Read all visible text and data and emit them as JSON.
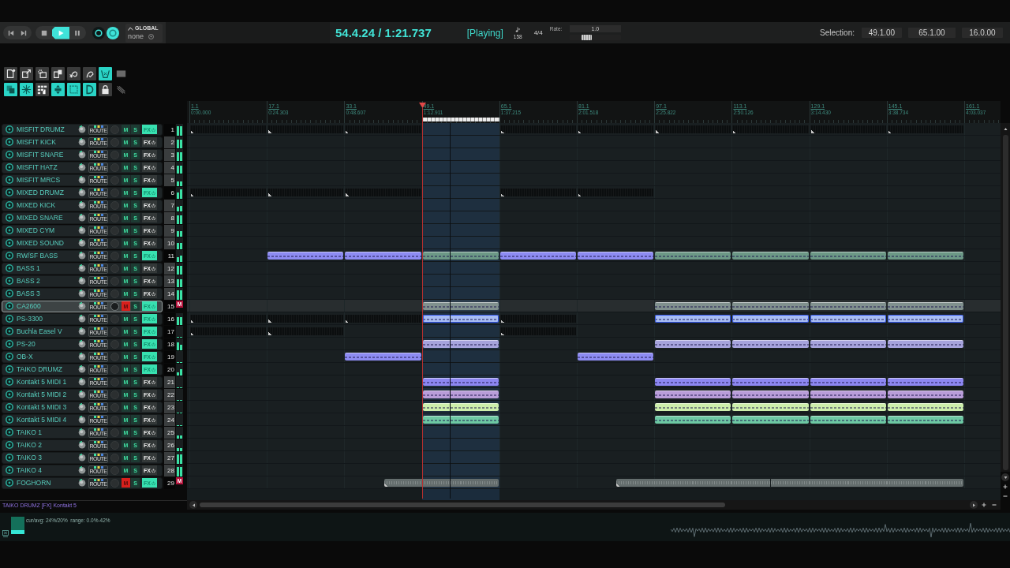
{
  "transport": {
    "groups": [
      {
        "kind": "pill",
        "buttons": [
          {
            "kind": "skipback",
            "on": false
          },
          {
            "kind": "skipforward",
            "on": false
          }
        ]
      },
      {
        "kind": "pill",
        "buttons": [
          {
            "kind": "stop",
            "on": false
          },
          {
            "kind": "play",
            "on": true
          },
          {
            "kind": "pause",
            "on": false
          }
        ]
      },
      {
        "kind": "plain",
        "buttons": [
          {
            "kind": "record",
            "on": false
          },
          {
            "kind": "repeat",
            "on": true
          }
        ]
      }
    ],
    "automation": {
      "label": "GLOBAL",
      "value": "none"
    }
  },
  "position": "54.4.24 / 1:21.737",
  "play_state": "[Playing]",
  "tempo": "158",
  "time_signature": "4/4",
  "rate": {
    "label": "Rate:",
    "value": "1.0",
    "level": 0.29
  },
  "selection": {
    "label": "Selection:",
    "start": "49.1.00",
    "end": "65.1.00",
    "length": "16.0.00"
  },
  "toolbar": {
    "rows": [
      {
        "buttons": [
          {
            "kind": "new",
            "on": false
          },
          {
            "kind": "saveas",
            "on": false
          },
          {
            "kind": "settings",
            "on": false
          },
          {
            "kind": "history",
            "on": false
          },
          {
            "kind": "erase",
            "on": false
          },
          {
            "kind": "apply",
            "on": false
          },
          {
            "kind": "envelope",
            "on": true
          },
          {
            "kind": "marquee",
            "on": false
          }
        ]
      },
      {
        "buttons": [
          {
            "kind": "copy",
            "on": true
          },
          {
            "kind": "burst",
            "on": true
          },
          {
            "kind": "grid",
            "on": false
          },
          {
            "kind": "expand",
            "on": true
          },
          {
            "kind": "snap",
            "on": true
          },
          {
            "kind": "loop",
            "on": true
          },
          {
            "kind": "lock",
            "on": false
          },
          {
            "kind": "trim",
            "on": false
          }
        ]
      }
    ]
  },
  "ruler": {
    "marks": [
      {
        "bar": "1.1",
        "time": "0:00.000"
      },
      {
        "bar": "17.1",
        "time": "0:24.303"
      },
      {
        "bar": "33.1",
        "time": "0:48.607"
      },
      {
        "bar": "49.1",
        "time": "1:12.911"
      },
      {
        "bar": "65.1",
        "time": "1:37.215"
      },
      {
        "bar": "81.1",
        "time": "2:01.518"
      },
      {
        "bar": "97.1",
        "time": "2:25.822"
      },
      {
        "bar": "113.1",
        "time": "2:50.126"
      },
      {
        "bar": "129.1",
        "time": "3:14.430"
      },
      {
        "bar": "145.1",
        "time": "3:38.734"
      },
      {
        "bar": "161.1",
        "time": "4:03.037"
      }
    ]
  },
  "tracks": [
    {
      "number": "1",
      "name": "MISFIT DRUMZ",
      "route_label": "ROUTE",
      "mute_label": "M",
      "solo_label": "S",
      "fx_label": "FX",
      "muted": false,
      "fx_on": true,
      "selected": false,
      "meter": [
        {
          "level": 0.9
        },
        {
          "level": 0.9
        }
      ],
      "slots": [
        {
          "kind": "empty",
          "selected": false
        },
        {
          "kind": "empty",
          "selected": false
        },
        {
          "kind": "empty",
          "selected": false
        },
        {
          "kind": "gap"
        },
        {
          "kind": "empty",
          "selected": false
        },
        {
          "kind": "empty",
          "selected": false
        },
        {
          "kind": "empty",
          "selected": false
        },
        {
          "kind": "empty",
          "selected": false
        },
        {
          "kind": "empty",
          "selected": false
        },
        {
          "kind": "empty",
          "selected": false
        }
      ]
    },
    {
      "number": "2",
      "name": "MISFIT KICK",
      "route_label": "ROUTE",
      "mute_label": "M",
      "solo_label": "S",
      "fx_label": "FX",
      "muted": false,
      "fx_on": false,
      "selected": false,
      "meter": [
        {
          "level": 0.8
        },
        {
          "level": 0.8
        }
      ]
    },
    {
      "number": "3",
      "name": "MISFIT SNARE",
      "route_label": "ROUTE",
      "mute_label": "M",
      "solo_label": "S",
      "fx_label": "FX",
      "muted": false,
      "fx_on": false,
      "selected": false,
      "meter": [
        {
          "level": 0.8
        },
        {
          "level": 0.8
        }
      ]
    },
    {
      "number": "4",
      "name": "MISFIT HATZ",
      "route_label": "ROUTE",
      "mute_label": "M",
      "solo_label": "S",
      "fx_label": "FX",
      "muted": false,
      "fx_on": false,
      "selected": false,
      "meter": [
        {
          "level": 0.7
        },
        {
          "level": 0.7
        }
      ]
    },
    {
      "number": "5",
      "name": "MISFIT MRCS",
      "route_label": "ROUTE",
      "mute_label": "M",
      "solo_label": "S",
      "fx_label": "FX",
      "muted": false,
      "fx_on": false,
      "selected": false,
      "meter": [
        {
          "level": 0.4
        },
        {
          "level": 0.4
        }
      ]
    },
    {
      "number": "6",
      "name": "MIXED DRUMZ",
      "route_label": "ROUTE",
      "mute_label": "M",
      "solo_label": "S",
      "fx_label": "FX",
      "muted": false,
      "fx_on": true,
      "selected": false,
      "meter": [
        {
          "level": 0.6
        },
        {
          "level": 0.9
        }
      ],
      "slots": [
        {
          "kind": "empty",
          "selected": false
        },
        {
          "kind": "empty",
          "selected": false
        },
        {
          "kind": "empty",
          "selected": false
        },
        {
          "kind": "gap"
        },
        {
          "kind": "empty",
          "selected": false
        },
        {
          "kind": "empty",
          "selected": false
        },
        {
          "kind": "gap"
        },
        {
          "kind": "gap"
        },
        {
          "kind": "gap"
        },
        {
          "kind": "gap"
        }
      ]
    },
    {
      "number": "7",
      "name": "MIXED KICK",
      "route_label": "ROUTE",
      "mute_label": "M",
      "solo_label": "S",
      "fx_label": "FX",
      "muted": false,
      "fx_on": false,
      "selected": false,
      "meter": [
        {
          "level": 0.4
        },
        {
          "level": 0.5
        }
      ]
    },
    {
      "number": "8",
      "name": "MIXED SNARE",
      "route_label": "ROUTE",
      "mute_label": "M",
      "solo_label": "S",
      "fx_label": "FX",
      "muted": false,
      "fx_on": false,
      "selected": false,
      "meter": [
        {
          "level": 0.8
        },
        {
          "level": 0.8
        }
      ]
    },
    {
      "number": "9",
      "name": "MIXED CYM",
      "route_label": "ROUTE",
      "mute_label": "M",
      "solo_label": "S",
      "fx_label": "FX",
      "muted": false,
      "fx_on": false,
      "selected": false,
      "meter": [
        {
          "level": 0.5
        },
        {
          "level": 0.5
        }
      ]
    },
    {
      "number": "10",
      "name": "MIXED SOUND",
      "route_label": "ROUTE",
      "mute_label": "M",
      "solo_label": "S",
      "fx_label": "FX",
      "muted": false,
      "fx_on": false,
      "selected": false,
      "meter": [
        {
          "level": 0.6
        },
        {
          "level": 0.6
        }
      ]
    },
    {
      "number": "11",
      "name": "RW/SF BASS",
      "route_label": "ROUTE",
      "mute_label": "M",
      "solo_label": "S",
      "fx_label": "FX",
      "muted": false,
      "fx_on": true,
      "selected": false,
      "meter": [
        {
          "level": 0.4
        },
        {
          "level": 0.6
        }
      ],
      "slots": [
        {
          "kind": "gap"
        },
        {
          "kind": "midi",
          "color": "#8d8bf2",
          "selected": false
        },
        {
          "kind": "midi",
          "color": "#8d8bf2",
          "selected": false
        },
        {
          "kind": "midi",
          "color": "#6c9886",
          "selected": false
        },
        {
          "kind": "midi",
          "color": "#8d8bf2",
          "selected": false
        },
        {
          "kind": "midi",
          "color": "#8d8bf2",
          "selected": false
        },
        {
          "kind": "midi",
          "color": "#6c9886",
          "selected": false
        },
        {
          "kind": "midi",
          "color": "#6c9886",
          "selected": false
        },
        {
          "kind": "midi",
          "color": "#6c9886",
          "selected": false
        },
        {
          "kind": "midi",
          "color": "#6c9886",
          "selected": false
        }
      ]
    },
    {
      "number": "12",
      "name": "BASS 1",
      "route_label": "ROUTE",
      "mute_label": "M",
      "solo_label": "S",
      "fx_label": "FX",
      "muted": false,
      "fx_on": false,
      "selected": false,
      "meter": [
        {
          "level": 0.8
        },
        {
          "level": 0.8
        }
      ]
    },
    {
      "number": "13",
      "name": "BASS 2",
      "route_label": "ROUTE",
      "mute_label": "M",
      "solo_label": "S",
      "fx_label": "FX",
      "muted": false,
      "fx_on": false,
      "selected": false,
      "meter": [
        {
          "level": 0.7
        },
        {
          "level": 0.7
        }
      ]
    },
    {
      "number": "14",
      "name": "BASS 3",
      "route_label": "ROUTE",
      "mute_label": "M",
      "solo_label": "S",
      "fx_label": "FX",
      "muted": false,
      "fx_on": false,
      "selected": false,
      "meter": [
        {
          "level": 0.9
        },
        {
          "level": 0.9
        }
      ]
    },
    {
      "number": "15",
      "name": "CA2600",
      "route_label": "ROUTE",
      "mute_label": "M",
      "solo_label": "S",
      "fx_label": "FX",
      "muted": true,
      "fx_on": true,
      "selected": true,
      "meter_badge": "M",
      "slots": [
        {
          "kind": "gap"
        },
        {
          "kind": "gap"
        },
        {
          "kind": "gap"
        },
        {
          "kind": "midi",
          "color": "#80908e",
          "selected": false
        },
        {
          "kind": "gap"
        },
        {
          "kind": "gap"
        },
        {
          "kind": "midi",
          "color": "#80908e",
          "selected": false
        },
        {
          "kind": "midi",
          "color": "#80908e",
          "selected": false
        },
        {
          "kind": "midi",
          "color": "#80908e",
          "selected": false
        },
        {
          "kind": "midi",
          "color": "#80908e",
          "selected": false
        }
      ]
    },
    {
      "number": "16",
      "name": "PS-3300",
      "route_label": "ROUTE",
      "mute_label": "M",
      "solo_label": "S",
      "fx_label": "FX",
      "muted": false,
      "fx_on": true,
      "selected": false,
      "meter": [
        {
          "level": 0.7
        },
        {
          "level": 0.7
        }
      ],
      "slots": [
        {
          "kind": "empty",
          "selected": false
        },
        {
          "kind": "empty",
          "selected": false
        },
        {
          "kind": "empty",
          "selected": false
        },
        {
          "kind": "midi",
          "color": "#a8bdf4",
          "selected": true
        },
        {
          "kind": "empty",
          "selected": false
        },
        {
          "kind": "gap"
        },
        {
          "kind": "midi",
          "color": "#a8bdf4",
          "selected": true
        },
        {
          "kind": "midi",
          "color": "#a8bdf4",
          "selected": true
        },
        {
          "kind": "midi",
          "color": "#a8bdf4",
          "selected": true
        },
        {
          "kind": "midi",
          "color": "#a8bdf4",
          "selected": true
        }
      ]
    },
    {
      "number": "17",
      "name": "Buchla Easel V",
      "route_label": "ROUTE",
      "mute_label": "M",
      "solo_label": "S",
      "fx_label": "FX",
      "muted": false,
      "fx_on": true,
      "selected": false,
      "meter": [
        {
          "level": 0
        },
        {
          "level": 0
        }
      ],
      "slots": [
        {
          "kind": "empty",
          "selected": false
        },
        {
          "kind": "empty",
          "selected": false
        },
        {
          "kind": "gap"
        },
        {
          "kind": "gap"
        },
        {
          "kind": "empty",
          "selected": false
        },
        {
          "kind": "gap"
        },
        {
          "kind": "gap"
        },
        {
          "kind": "gap"
        },
        {
          "kind": "gap"
        },
        {
          "kind": "gap"
        }
      ]
    },
    {
      "number": "18",
      "name": "PS-20",
      "route_label": "ROUTE",
      "mute_label": "M",
      "solo_label": "S",
      "fx_label": "FX",
      "muted": false,
      "fx_on": true,
      "selected": false,
      "meter": [
        {
          "level": 0.7
        },
        {
          "level": 0.5
        }
      ],
      "slots": [
        {
          "kind": "gap"
        },
        {
          "kind": "gap"
        },
        {
          "kind": "gap"
        },
        {
          "kind": "midi",
          "color": "#a6a3dc",
          "selected": false
        },
        {
          "kind": "gap"
        },
        {
          "kind": "gap"
        },
        {
          "kind": "midi",
          "color": "#a6a3dc",
          "selected": false
        },
        {
          "kind": "midi",
          "color": "#a6a3dc",
          "selected": false
        },
        {
          "kind": "midi",
          "color": "#a6a3dc",
          "selected": false
        },
        {
          "kind": "midi",
          "color": "#a6a3dc",
          "selected": false
        }
      ]
    },
    {
      "number": "19",
      "name": "OB-X",
      "route_label": "ROUTE",
      "mute_label": "M",
      "solo_label": "S",
      "fx_label": "FX",
      "muted": false,
      "fx_on": true,
      "selected": false,
      "meter": [
        {
          "level": 0
        },
        {
          "level": 0
        }
      ],
      "slots": [
        {
          "kind": "gap"
        },
        {
          "kind": "gap"
        },
        {
          "kind": "midi",
          "color": "#8d8bf2",
          "selected": false
        },
        {
          "kind": "gap"
        },
        {
          "kind": "gap"
        },
        {
          "kind": "midi",
          "color": "#8d8bf2",
          "selected": false
        },
        {
          "kind": "gap"
        },
        {
          "kind": "gap"
        },
        {
          "kind": "gap"
        },
        {
          "kind": "gap"
        }
      ]
    },
    {
      "number": "20",
      "name": "TAIKO DRUMZ",
      "route_label": "ROUTE",
      "mute_label": "M",
      "solo_label": "S",
      "fx_label": "FX",
      "muted": false,
      "fx_on": true,
      "selected": false,
      "meter": [
        {
          "level": 0.3
        },
        {
          "level": 0.6
        }
      ]
    },
    {
      "number": "21",
      "name": "Kontakt 5 MIDI 1",
      "route_label": "ROUTE",
      "mute_label": "M",
      "solo_label": "S",
      "fx_label": "FX",
      "muted": false,
      "fx_on": false,
      "selected": false,
      "meter": [
        {
          "level": 0
        },
        {
          "level": 0
        }
      ],
      "slots": [
        {
          "kind": "gap"
        },
        {
          "kind": "gap"
        },
        {
          "kind": "gap"
        },
        {
          "kind": "midi",
          "color": "#8d87f2",
          "selected": false
        },
        {
          "kind": "gap"
        },
        {
          "kind": "gap"
        },
        {
          "kind": "midi",
          "color": "#8d87f2",
          "selected": false
        },
        {
          "kind": "midi",
          "color": "#8d87f2",
          "selected": false
        },
        {
          "kind": "midi",
          "color": "#8d87f2",
          "selected": false
        },
        {
          "kind": "midi",
          "color": "#8d87f2",
          "selected": false
        }
      ]
    },
    {
      "number": "22",
      "name": "Kontakt 5 MIDI 2",
      "route_label": "ROUTE",
      "mute_label": "M",
      "solo_label": "S",
      "fx_label": "FX",
      "muted": false,
      "fx_on": false,
      "selected": false,
      "meter": [
        {
          "level": 0
        },
        {
          "level": 0
        }
      ],
      "slots": [
        {
          "kind": "gap"
        },
        {
          "kind": "gap"
        },
        {
          "kind": "gap"
        },
        {
          "kind": "midi",
          "color": "#b99dd9",
          "selected": false
        },
        {
          "kind": "gap"
        },
        {
          "kind": "gap"
        },
        {
          "kind": "midi",
          "color": "#b99dd9",
          "selected": false
        },
        {
          "kind": "midi",
          "color": "#b99dd9",
          "selected": false
        },
        {
          "kind": "midi",
          "color": "#b99dd9",
          "selected": false
        },
        {
          "kind": "midi",
          "color": "#b99dd9",
          "selected": false
        }
      ]
    },
    {
      "number": "23",
      "name": "Kontakt 5 MIDI 3",
      "route_label": "ROUTE",
      "mute_label": "M",
      "solo_label": "S",
      "fx_label": "FX",
      "muted": false,
      "fx_on": false,
      "selected": false,
      "meter": [
        {
          "level": 0
        },
        {
          "level": 0
        }
      ],
      "slots": [
        {
          "kind": "gap"
        },
        {
          "kind": "gap"
        },
        {
          "kind": "gap"
        },
        {
          "kind": "midi",
          "color": "#cdeeab",
          "selected": false
        },
        {
          "kind": "gap"
        },
        {
          "kind": "gap"
        },
        {
          "kind": "midi",
          "color": "#cdeeab",
          "selected": false
        },
        {
          "kind": "midi",
          "color": "#cdeeab",
          "selected": false
        },
        {
          "kind": "midi",
          "color": "#cdeeab",
          "selected": false
        },
        {
          "kind": "midi",
          "color": "#cdeeab",
          "selected": false
        }
      ]
    },
    {
      "number": "24",
      "name": "Kontakt 5 MIDI 4",
      "route_label": "ROUTE",
      "mute_label": "M",
      "solo_label": "S",
      "fx_label": "FX",
      "muted": false,
      "fx_on": false,
      "selected": false,
      "meter": [
        {
          "level": 0
        },
        {
          "level": 0
        }
      ],
      "slots": [
        {
          "kind": "gap"
        },
        {
          "kind": "gap"
        },
        {
          "kind": "gap"
        },
        {
          "kind": "midi",
          "color": "#6dc8a3",
          "selected": false
        },
        {
          "kind": "gap"
        },
        {
          "kind": "gap"
        },
        {
          "kind": "midi",
          "color": "#6dc8a3",
          "selected": false
        },
        {
          "kind": "midi",
          "color": "#6dc8a3",
          "selected": false
        },
        {
          "kind": "midi",
          "color": "#6dc8a3",
          "selected": false
        },
        {
          "kind": "midi",
          "color": "#6dc8a3",
          "selected": false
        }
      ]
    },
    {
      "number": "25",
      "name": "TAIKO 1",
      "route_label": "ROUTE",
      "mute_label": "M",
      "solo_label": "S",
      "fx_label": "FX",
      "muted": false,
      "fx_on": false,
      "selected": false,
      "meter": [
        {
          "level": 0.3
        },
        {
          "level": 0.3
        }
      ]
    },
    {
      "number": "26",
      "name": "TAIKO 2",
      "route_label": "ROUTE",
      "mute_label": "M",
      "solo_label": "S",
      "fx_label": "FX",
      "muted": false,
      "fx_on": false,
      "selected": false,
      "meter": [
        {
          "level": 0.3
        },
        {
          "level": 0.3
        }
      ]
    },
    {
      "number": "27",
      "name": "TAIKO 3",
      "route_label": "ROUTE",
      "mute_label": "M",
      "solo_label": "S",
      "fx_label": "FX",
      "muted": false,
      "fx_on": false,
      "selected": false,
      "meter": [
        {
          "level": 0.9
        },
        {
          "level": 0.9
        }
      ]
    },
    {
      "number": "28",
      "name": "TAIKO 4",
      "route_label": "ROUTE",
      "mute_label": "M",
      "solo_label": "S",
      "fx_label": "FX",
      "muted": false,
      "fx_on": false,
      "selected": false,
      "meter": [
        {
          "level": 0.9
        },
        {
          "level": 0.9
        }
      ]
    },
    {
      "number": "29",
      "name": "FOGHORN",
      "route_label": "ROUTE",
      "mute_label": "M",
      "solo_label": "S",
      "fx_label": "FX",
      "muted": true,
      "fx_on": true,
      "selected": false,
      "meter_badge": "M",
      "slots": [
        {
          "kind": "gap"
        },
        {
          "kind": "gap"
        },
        {
          "kind": "gap"
        },
        {
          "kind": "gap"
        },
        {
          "kind": "gap"
        },
        {
          "kind": "audio",
          "color": "#646d6d",
          "selected": false
        },
        {
          "kind": "audio",
          "color": "#646d6d",
          "selected": false
        },
        {
          "kind": "audio",
          "color": "#646d6d",
          "selected": false
        },
        {
          "kind": "gap"
        },
        {
          "kind": "gap"
        },
        {
          "kind": "gap"
        },
        {
          "kind": "audio",
          "color": "#646d6d",
          "selected": false
        },
        {
          "kind": "audio",
          "color": "#646d6d",
          "selected": false
        },
        {
          "kind": "audio",
          "color": "#646d6d",
          "selected": false
        },
        {
          "kind": "audio",
          "color": "#646d6d",
          "selected": false
        },
        {
          "kind": "audio",
          "color": "#646d6d",
          "selected": false
        },
        {
          "kind": "audio",
          "color": "#646d6d",
          "selected": false
        },
        {
          "kind": "audio",
          "color": "#646d6d",
          "selected": false
        },
        {
          "kind": "audio",
          "color": "#646d6d",
          "selected": false
        },
        {
          "kind": "audio",
          "color": "#646d6d",
          "selected": false
        }
      ]
    }
  ],
  "status_text": "TAIKO DRUMZ [FX] Kontakt 5",
  "performance": {
    "text": "cur/avg: 24%/20%  range: 0.0%-42%",
    "level": 0.24
  }
}
